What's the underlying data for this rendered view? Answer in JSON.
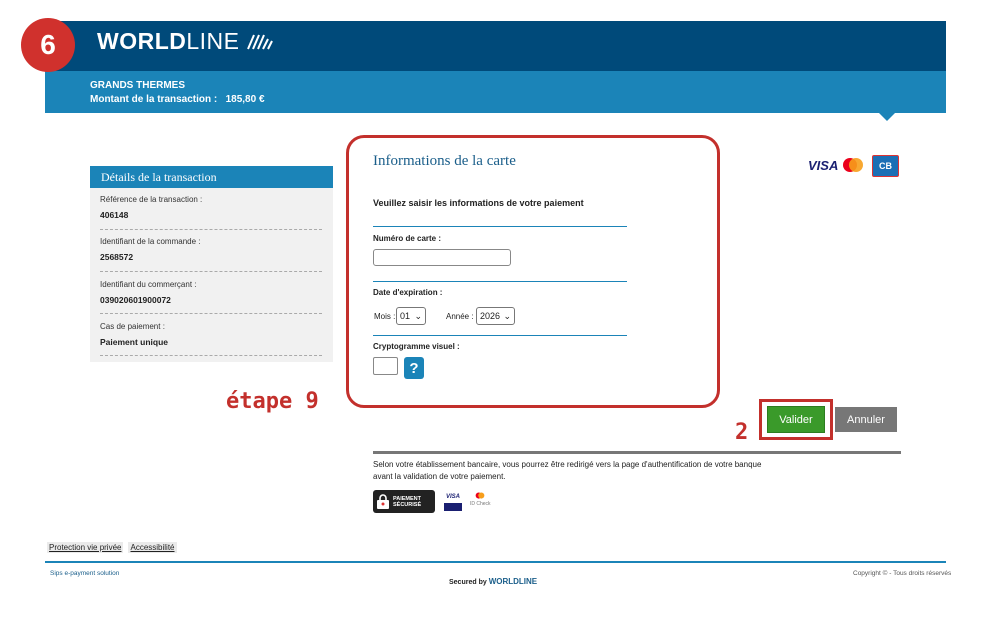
{
  "step_number": "6",
  "header": {
    "logo_bold": "WORLD",
    "logo_light": "LINE",
    "merchant_name": "GRANDS THERMES",
    "amount_label": "Montant de la transaction :",
    "amount_value": "185,80 €"
  },
  "transaction_panel": {
    "title": "Détails de la transaction",
    "fields": [
      {
        "label": "Référence de la transaction :",
        "value": "406148"
      },
      {
        "label": "Identifiant de la commande :",
        "value": "2568572"
      },
      {
        "label": "Identifiant du commerçant :",
        "value": "039020601900072"
      },
      {
        "label": "Cas de paiement :",
        "value": "Paiement unique"
      }
    ]
  },
  "card_form": {
    "title": "Informations de la carte",
    "intro": "Veuillez saisir les informations de votre paiement",
    "card_number_label": "Numéro de carte :",
    "card_number_value": "",
    "expiry_label": "Date d'expiration :",
    "month_label": "Mois :",
    "month_value": "01",
    "year_label": "Année :",
    "year_value": "2026",
    "cvv_label": "Cryptogramme visuel :",
    "cvv_value": "",
    "help_symbol": "?"
  },
  "card_logos": {
    "visa": "VISA",
    "cb": "CB"
  },
  "annotations": {
    "etape": "étape 9",
    "two": "2"
  },
  "buttons": {
    "validate": "Valider",
    "cancel": "Annuler"
  },
  "bank_note": "Selon votre établissement bancaire, vous pourrez être redirigé vers la page d'authentification de votre banque avant la validation de votre paiement.",
  "secure_badge": {
    "line1": "PAIEMENT",
    "line2": "SÉCURISÉ"
  },
  "small_logos": {
    "visa": "VISA",
    "mc": "ID Check"
  },
  "footer": {
    "privacy": "Protection vie privée",
    "accessibility": "Accessibilité",
    "left": "Sips e-payment solution",
    "secured_by": "Secured by",
    "brand": "WORLDLINE",
    "copyright": "Copyright © - Tous droits réservés"
  },
  "colors": {
    "header_dark": "#004a7a",
    "header_light": "#1b84b8",
    "accent_red": "#c3302c",
    "validate_green": "#3a9a2a"
  }
}
